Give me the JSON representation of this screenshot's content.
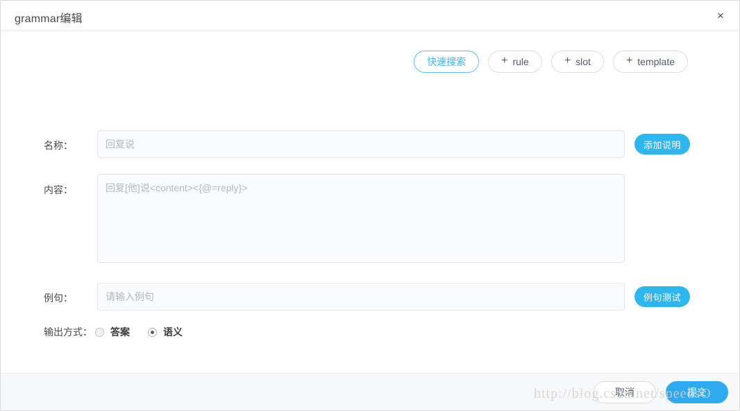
{
  "dialog": {
    "title": "grammar编辑",
    "close_icon": "close-icon",
    "close_glyph": "×"
  },
  "toolbar": {
    "buttons": [
      {
        "label": "快速搜索",
        "style": "primary",
        "plus": ""
      },
      {
        "label": "rule",
        "style": "default",
        "plus": "+"
      },
      {
        "label": "slot",
        "style": "default",
        "plus": "+"
      },
      {
        "label": "template",
        "style": "default",
        "plus": "+"
      }
    ]
  },
  "form": {
    "name": {
      "label": "名称：",
      "value": "回复说",
      "placeholder": "回复说",
      "action_button": "添加说明"
    },
    "content": {
      "label": "内容：",
      "value": "回复[他]说<content><{@=reply}>",
      "placeholder": "回复[他]说<content><{@=reply}>"
    },
    "example": {
      "label": "例句：",
      "value": "",
      "placeholder": "请输入例句",
      "action_button": "例句测试"
    },
    "output_mode": {
      "label": "输出方式：",
      "options": [
        {
          "label": "答案",
          "checked": false
        },
        {
          "label": "语义",
          "checked": true
        }
      ]
    }
  },
  "footer": {
    "cancel_label": "取消",
    "submit_label": "提交"
  },
  "watermark": {
    "text": "http://blog.csdn.net/speedsO"
  },
  "colors": {
    "accent": "#2eaaf0",
    "accent_light": "#2eb7ef",
    "pill_border": "#dcdee2",
    "pill_primary_border": "#57c0ed",
    "field_bg": "#fafbfc",
    "field_border": "#e3e6eb",
    "footer_bg": "#f7f8fa"
  }
}
